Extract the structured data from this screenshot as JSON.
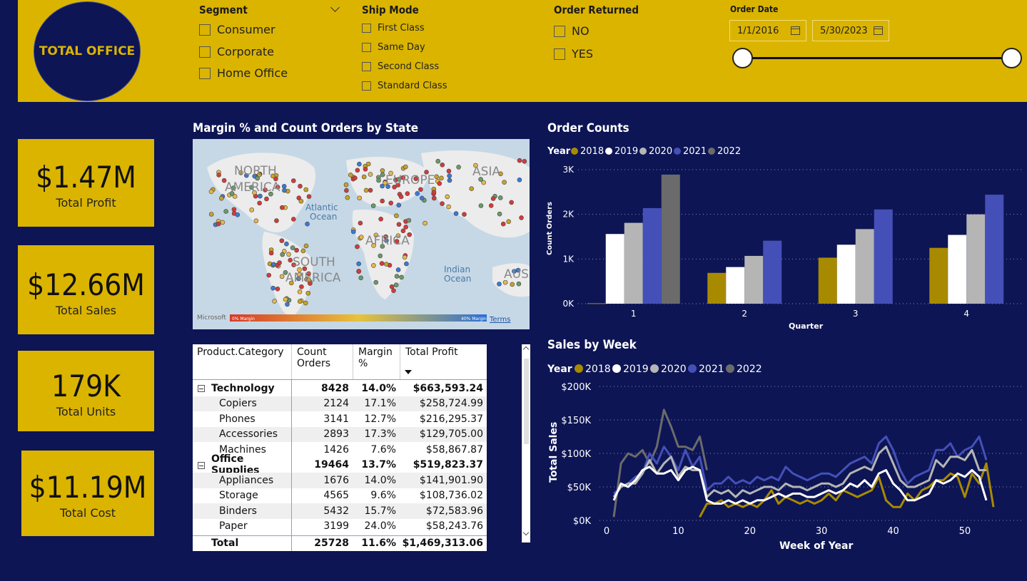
{
  "brand": {
    "title": "TOTAL OFFICE"
  },
  "filters": {
    "segment": {
      "title": "Segment",
      "options": [
        "Consumer",
        "Corporate",
        "Home Office"
      ]
    },
    "ship_mode": {
      "title": "Ship Mode",
      "options": [
        "First Class",
        "Same Day",
        "Second Class",
        "Standard Class"
      ]
    },
    "order_returned": {
      "title": "Order Returned",
      "options": [
        "NO",
        "YES"
      ]
    },
    "order_date": {
      "title": "Order Date",
      "start": "1/1/2016",
      "end": "5/30/2023",
      "range_fraction": [
        0.0,
        1.0
      ]
    }
  },
  "kpis": [
    {
      "value": "$1.47M",
      "caption": "Total Profit"
    },
    {
      "value": "$12.66M",
      "caption": "Total Sales"
    },
    {
      "value": "179K",
      "caption": "Total Units"
    },
    {
      "value": "$11.19M",
      "caption": "Total Cost"
    }
  ],
  "map": {
    "title": "Margin % and Count Orders by State",
    "labels": [
      "NORTH",
      "AMERICA",
      "EUROPE",
      "ASIA",
      "Atlantic",
      "Ocean",
      "AFRICA",
      "SOUTH",
      "AMERICA",
      "Indian",
      "Ocean",
      "AUS"
    ],
    "legend_min": "0% Margin",
    "legend_max": "40% Margin",
    "provider": "Microsoft",
    "terms": "Terms"
  },
  "table": {
    "headers": [
      "Product.Category",
      "Count Orders",
      "Margin %",
      "Total Profit"
    ],
    "groups": [
      {
        "name": "Technology",
        "count": "8428",
        "margin": "14.0%",
        "profit": "$663,593.24",
        "rows": [
          [
            "Copiers",
            "2124",
            "17.1%",
            "$258,724.99"
          ],
          [
            "Phones",
            "3141",
            "12.7%",
            "$216,295.37"
          ],
          [
            "Accessories",
            "2893",
            "17.3%",
            "$129,705.00"
          ],
          [
            "Machines",
            "1426",
            "7.6%",
            "$58,867.87"
          ]
        ]
      },
      {
        "name": "Office Supplies",
        "count": "19464",
        "margin": "13.7%",
        "profit": "$519,823.37",
        "rows": [
          [
            "Appliances",
            "1676",
            "14.0%",
            "$141,901.90"
          ],
          [
            "Storage",
            "4565",
            "9.6%",
            "$108,736.02"
          ],
          [
            "Binders",
            "5432",
            "15.7%",
            "$72,583.96"
          ],
          [
            "Paper",
            "3199",
            "24.0%",
            "$58,243.76"
          ]
        ]
      }
    ],
    "total": [
      "Total",
      "25728",
      "11.6%",
      "$1,469,313.06"
    ]
  },
  "colors": {
    "2018": "#a88a00",
    "2019": "#ffffff",
    "2020": "#b5b5b5",
    "2021": "#4450b8",
    "2022": "#6b6b6b"
  },
  "chart_data": [
    {
      "type": "bar",
      "title": "Order Counts",
      "legend_title": "Year",
      "xlabel": "Quarter",
      "ylabel": "Count Orders",
      "categories": [
        "1",
        "2",
        "3",
        "4"
      ],
      "yticks": [
        "0K",
        "1K",
        "2K",
        "3K"
      ],
      "ylim": [
        0,
        3000
      ],
      "series": [
        {
          "name": "2018",
          "values": [
            10,
            690,
            1030,
            1250
          ]
        },
        {
          "name": "2019",
          "values": [
            1560,
            820,
            1320,
            1540
          ]
        },
        {
          "name": "2020",
          "values": [
            1810,
            1070,
            1670,
            2000
          ]
        },
        {
          "name": "2021",
          "values": [
            2140,
            1410,
            2110,
            2440
          ]
        },
        {
          "name": "2022",
          "values": [
            2890,
            null,
            null,
            null
          ]
        }
      ]
    },
    {
      "type": "line",
      "title": "Sales by Week",
      "legend_title": "Year",
      "xlabel": "Week of Year",
      "ylabel": "Total Sales",
      "yticks": [
        "$0K",
        "$50K",
        "$100K",
        "$150K",
        "$200K"
      ],
      "xticks": [
        "0",
        "10",
        "20",
        "30",
        "40",
        "50"
      ],
      "xlim": [
        0,
        53
      ],
      "ylim": [
        0,
        200000
      ],
      "series": [
        {
          "name": "2018",
          "x_start": 13,
          "values": [
            5000,
            25000,
            25000,
            30000,
            20000,
            25000,
            20000,
            25000,
            20000,
            30000,
            45000,
            25000,
            35000,
            30000,
            25000,
            30000,
            25000,
            30000,
            40000,
            30000,
            45000,
            40000,
            35000,
            40000,
            45000,
            65000,
            30000,
            20000,
            20000,
            40000,
            30000,
            45000,
            50000,
            60000,
            60000,
            70000,
            65000,
            35000,
            70000,
            55000,
            85000,
            20000
          ]
        },
        {
          "name": "2019",
          "x_start": 1,
          "values": [
            30000,
            55000,
            50000,
            60000,
            75000,
            80000,
            70000,
            70000,
            75000,
            60000,
            75000,
            80000,
            75000,
            30000,
            25000,
            25000,
            30000,
            25000,
            30000,
            25000,
            30000,
            30000,
            35000,
            40000,
            35000,
            40000,
            40000,
            35000,
            35000,
            40000,
            45000,
            40000,
            45000,
            55000,
            50000,
            60000,
            50000,
            70000,
            75000,
            55000,
            45000,
            30000,
            30000,
            35000,
            40000,
            60000,
            55000,
            60000,
            70000,
            65000,
            75000,
            65000,
            30000
          ]
        },
        {
          "name": "2020",
          "x_start": 1,
          "values": [
            35000,
            50000,
            55000,
            55000,
            70000,
            90000,
            70000,
            85000,
            95000,
            65000,
            80000,
            75000,
            75000,
            35000,
            45000,
            40000,
            45000,
            35000,
            45000,
            40000,
            45000,
            50000,
            50000,
            45000,
            55000,
            50000,
            50000,
            45000,
            50000,
            55000,
            55000,
            50000,
            55000,
            70000,
            75000,
            80000,
            75000,
            100000,
            110000,
            85000,
            60000,
            50000,
            50000,
            55000,
            60000,
            90000,
            80000,
            95000,
            95000,
            90000,
            105000,
            75000,
            75000
          ]
        },
        {
          "name": "2021",
          "x_start": 1,
          "values": [
            40000,
            50000,
            55000,
            65000,
            70000,
            100000,
            85000,
            110000,
            95000,
            75000,
            105000,
            80000,
            95000,
            45000,
            55000,
            55000,
            65000,
            55000,
            60000,
            55000,
            65000,
            60000,
            65000,
            60000,
            80000,
            70000,
            65000,
            60000,
            65000,
            70000,
            70000,
            65000,
            75000,
            85000,
            90000,
            95000,
            85000,
            115000,
            125000,
            105000,
            75000,
            55000,
            65000,
            70000,
            75000,
            105000,
            105000,
            115000,
            95000,
            105000,
            110000,
            125000,
            90000
          ]
        },
        {
          "name": "2022",
          "x_start": 1,
          "values": [
            5000,
            85000,
            100000,
            95000,
            105000,
            85000,
            110000,
            165000,
            140000,
            110000,
            110000,
            105000,
            125000,
            75000
          ]
        }
      ]
    }
  ]
}
